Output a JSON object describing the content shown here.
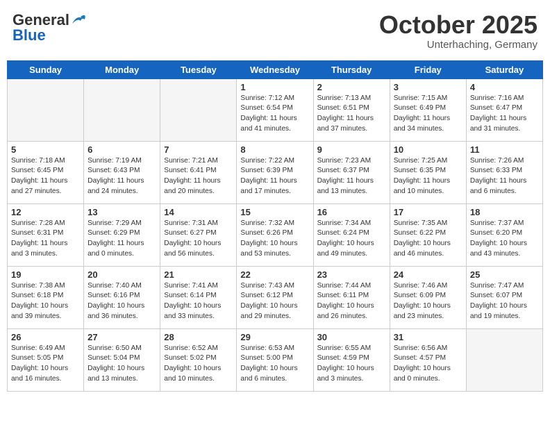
{
  "header": {
    "logo_general": "General",
    "logo_blue": "Blue",
    "month": "October 2025",
    "location": "Unterhaching, Germany"
  },
  "days_of_week": [
    "Sunday",
    "Monday",
    "Tuesday",
    "Wednesday",
    "Thursday",
    "Friday",
    "Saturday"
  ],
  "weeks": [
    [
      {
        "day": "",
        "empty": true
      },
      {
        "day": "",
        "empty": true
      },
      {
        "day": "",
        "empty": true
      },
      {
        "day": "1",
        "info": "Sunrise: 7:12 AM\nSunset: 6:54 PM\nDaylight: 11 hours\nand 41 minutes."
      },
      {
        "day": "2",
        "info": "Sunrise: 7:13 AM\nSunset: 6:51 PM\nDaylight: 11 hours\nand 37 minutes."
      },
      {
        "day": "3",
        "info": "Sunrise: 7:15 AM\nSunset: 6:49 PM\nDaylight: 11 hours\nand 34 minutes."
      },
      {
        "day": "4",
        "info": "Sunrise: 7:16 AM\nSunset: 6:47 PM\nDaylight: 11 hours\nand 31 minutes."
      }
    ],
    [
      {
        "day": "5",
        "info": "Sunrise: 7:18 AM\nSunset: 6:45 PM\nDaylight: 11 hours\nand 27 minutes."
      },
      {
        "day": "6",
        "info": "Sunrise: 7:19 AM\nSunset: 6:43 PM\nDaylight: 11 hours\nand 24 minutes."
      },
      {
        "day": "7",
        "info": "Sunrise: 7:21 AM\nSunset: 6:41 PM\nDaylight: 11 hours\nand 20 minutes."
      },
      {
        "day": "8",
        "info": "Sunrise: 7:22 AM\nSunset: 6:39 PM\nDaylight: 11 hours\nand 17 minutes."
      },
      {
        "day": "9",
        "info": "Sunrise: 7:23 AM\nSunset: 6:37 PM\nDaylight: 11 hours\nand 13 minutes."
      },
      {
        "day": "10",
        "info": "Sunrise: 7:25 AM\nSunset: 6:35 PM\nDaylight: 11 hours\nand 10 minutes."
      },
      {
        "day": "11",
        "info": "Sunrise: 7:26 AM\nSunset: 6:33 PM\nDaylight: 11 hours\nand 6 minutes."
      }
    ],
    [
      {
        "day": "12",
        "info": "Sunrise: 7:28 AM\nSunset: 6:31 PM\nDaylight: 11 hours\nand 3 minutes."
      },
      {
        "day": "13",
        "info": "Sunrise: 7:29 AM\nSunset: 6:29 PM\nDaylight: 11 hours\nand 0 minutes."
      },
      {
        "day": "14",
        "info": "Sunrise: 7:31 AM\nSunset: 6:27 PM\nDaylight: 10 hours\nand 56 minutes."
      },
      {
        "day": "15",
        "info": "Sunrise: 7:32 AM\nSunset: 6:26 PM\nDaylight: 10 hours\nand 53 minutes."
      },
      {
        "day": "16",
        "info": "Sunrise: 7:34 AM\nSunset: 6:24 PM\nDaylight: 10 hours\nand 49 minutes."
      },
      {
        "day": "17",
        "info": "Sunrise: 7:35 AM\nSunset: 6:22 PM\nDaylight: 10 hours\nand 46 minutes."
      },
      {
        "day": "18",
        "info": "Sunrise: 7:37 AM\nSunset: 6:20 PM\nDaylight: 10 hours\nand 43 minutes."
      }
    ],
    [
      {
        "day": "19",
        "info": "Sunrise: 7:38 AM\nSunset: 6:18 PM\nDaylight: 10 hours\nand 39 minutes."
      },
      {
        "day": "20",
        "info": "Sunrise: 7:40 AM\nSunset: 6:16 PM\nDaylight: 10 hours\nand 36 minutes."
      },
      {
        "day": "21",
        "info": "Sunrise: 7:41 AM\nSunset: 6:14 PM\nDaylight: 10 hours\nand 33 minutes."
      },
      {
        "day": "22",
        "info": "Sunrise: 7:43 AM\nSunset: 6:12 PM\nDaylight: 10 hours\nand 29 minutes."
      },
      {
        "day": "23",
        "info": "Sunrise: 7:44 AM\nSunset: 6:11 PM\nDaylight: 10 hours\nand 26 minutes."
      },
      {
        "day": "24",
        "info": "Sunrise: 7:46 AM\nSunset: 6:09 PM\nDaylight: 10 hours\nand 23 minutes."
      },
      {
        "day": "25",
        "info": "Sunrise: 7:47 AM\nSunset: 6:07 PM\nDaylight: 10 hours\nand 19 minutes."
      }
    ],
    [
      {
        "day": "26",
        "info": "Sunrise: 6:49 AM\nSunset: 5:05 PM\nDaylight: 10 hours\nand 16 minutes."
      },
      {
        "day": "27",
        "info": "Sunrise: 6:50 AM\nSunset: 5:04 PM\nDaylight: 10 hours\nand 13 minutes."
      },
      {
        "day": "28",
        "info": "Sunrise: 6:52 AM\nSunset: 5:02 PM\nDaylight: 10 hours\nand 10 minutes."
      },
      {
        "day": "29",
        "info": "Sunrise: 6:53 AM\nSunset: 5:00 PM\nDaylight: 10 hours\nand 6 minutes."
      },
      {
        "day": "30",
        "info": "Sunrise: 6:55 AM\nSunset: 4:59 PM\nDaylight: 10 hours\nand 3 minutes."
      },
      {
        "day": "31",
        "info": "Sunrise: 6:56 AM\nSunset: 4:57 PM\nDaylight: 10 hours\nand 0 minutes."
      },
      {
        "day": "",
        "empty": true
      }
    ]
  ]
}
